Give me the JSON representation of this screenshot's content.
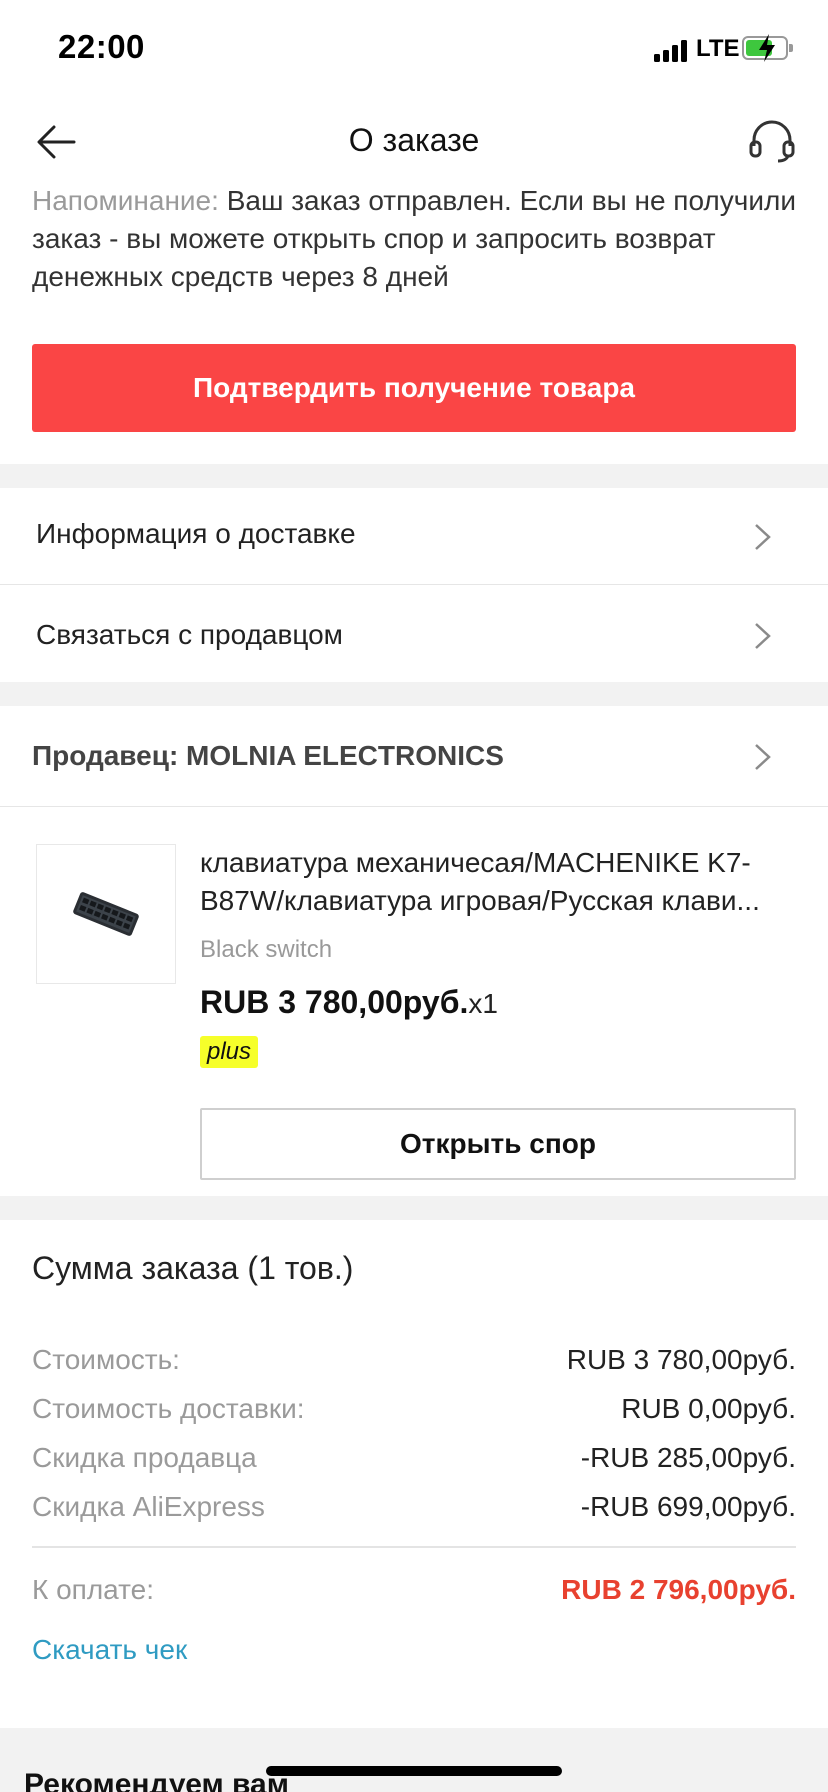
{
  "status_bar": {
    "time": "22:00",
    "network": "LTE"
  },
  "header": {
    "title": "О заказе"
  },
  "reminder": {
    "label": "Напоминание:",
    "text": "Ваш заказ отправлен. Если вы не получили заказ - вы можете открыть спор и запросить возврат денежных средств через 8 дней"
  },
  "confirm_button": "Подтвердить получение товара",
  "menu": {
    "delivery_info": "Информация о доставке",
    "contact_seller": "Связаться с продавцом"
  },
  "seller": {
    "label": "Продавец: MOLNIA ELECTRONICS"
  },
  "product": {
    "title": "клавиатура механичесая/MACHENIKE K7-B87W/клавиатура игровая/Русская клави...",
    "variant": "Black switch",
    "price": "RUB 3 780,00руб.",
    "qty": "x1",
    "badge": "plus"
  },
  "dispute_button": "Открыть спор",
  "summary": {
    "title": "Сумма заказа (1 тов.)",
    "lines": [
      {
        "label": "Стоимость:",
        "value": "RUB 3 780,00руб."
      },
      {
        "label": "Стоимость доставки:",
        "value": "RUB 0,00руб."
      },
      {
        "label": "Скидка продавца",
        "value": "-RUB 285,00руб."
      },
      {
        "label": "Скидка AliExpress",
        "value": "-RUB 699,00руб."
      }
    ],
    "total_label": "К оплате:",
    "total_value": "RUB 2 796,00руб.",
    "download": "Скачать чек"
  },
  "recommend_title": "Рекомендуем вам",
  "colors": {
    "accent": "#fa4545",
    "total": "#e8412f",
    "link": "#2f9bc2",
    "plus_badge": "#f6ff2a"
  }
}
